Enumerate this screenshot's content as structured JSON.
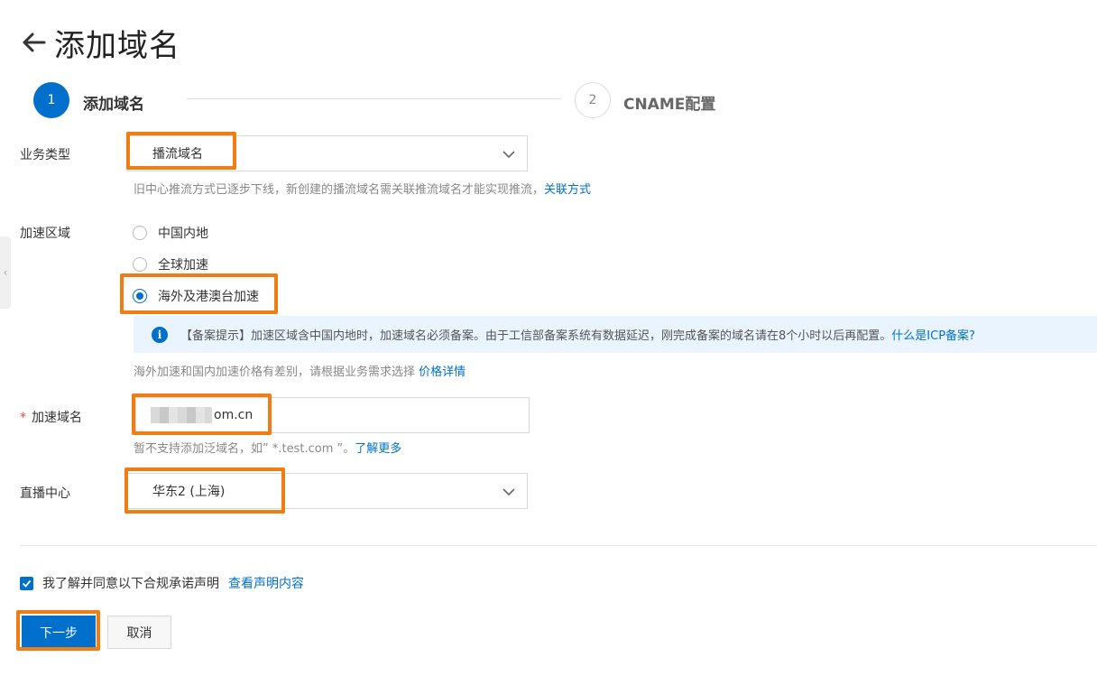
{
  "header": {
    "title": "添加域名"
  },
  "steps": [
    {
      "number": "1",
      "label": "添加域名"
    },
    {
      "number": "2",
      "label": "CNAME配置"
    }
  ],
  "form": {
    "business_type": {
      "label": "业务类型",
      "value": "播流域名",
      "help_text": "旧中心推流方式已逐步下线，新创建的播流域名需关联推流域名才能实现推流，",
      "help_link": "关联方式"
    },
    "region": {
      "label": "加速区域",
      "options": [
        "中国内地",
        "全球加速",
        "海外及港澳台加速"
      ],
      "selected": "海外及港澳台加速",
      "notice": "【备案提示】加速区域含中国内地时，加速域名必须备案。由于工信部备案系统有数据延迟，刚完成备案的域名请在8个小时以后再配置。",
      "notice_link": "什么是ICP备案?",
      "help_text": "海外加速和国内加速价格有差别，请根据业务需求选择",
      "help_link": "价格详情"
    },
    "domain": {
      "label": "加速域名",
      "required_mark": "*",
      "value_suffix": "om.cn",
      "help_text": "暂不支持添加泛域名，如” *.test.com ”。",
      "help_link": "了解更多"
    },
    "live_center": {
      "label": "直播中心",
      "value": "华东2 (上海)"
    }
  },
  "agreement": {
    "checked": true,
    "text": "我了解并同意以下合规承诺声明",
    "link": "查看声明内容"
  },
  "buttons": {
    "next": "下一步",
    "cancel": "取消"
  },
  "colors": {
    "primary": "#0070cc",
    "highlight": "#f07c14",
    "notice_bg": "#e9f4ff"
  }
}
